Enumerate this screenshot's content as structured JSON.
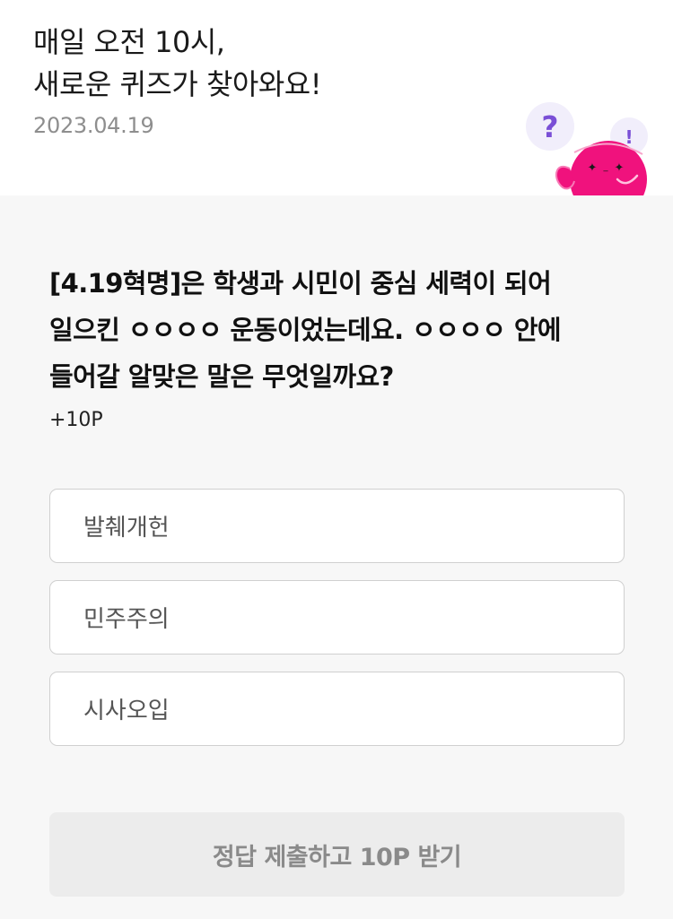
{
  "header": {
    "headline_line1": "매일 오전 10시,",
    "headline_line2": "새로운 퀴즈가 찾아와요!",
    "date": "2023.04.19"
  },
  "mascot": {
    "question_mark": "?",
    "exclamation_mark": "!",
    "colors": {
      "body": "#f0127d",
      "bubble": "#f1eefb",
      "symbol": "#7a4fd6"
    }
  },
  "quiz": {
    "question_line1": "[4.19혁명]은 학생과 시민이 중심 세력이 되어",
    "question_line2": "일으킨 ㅇㅇㅇㅇ 운동이었는데요. ㅇㅇㅇㅇ 안에",
    "question_line3": "들어갈 알맞은 말은 무엇일까요?",
    "points": "+10P",
    "options": [
      {
        "label": "발췌개헌"
      },
      {
        "label": "민주주의"
      },
      {
        "label": "시사오입"
      }
    ],
    "submit_label": "정답 제출하고 10P 받기"
  }
}
